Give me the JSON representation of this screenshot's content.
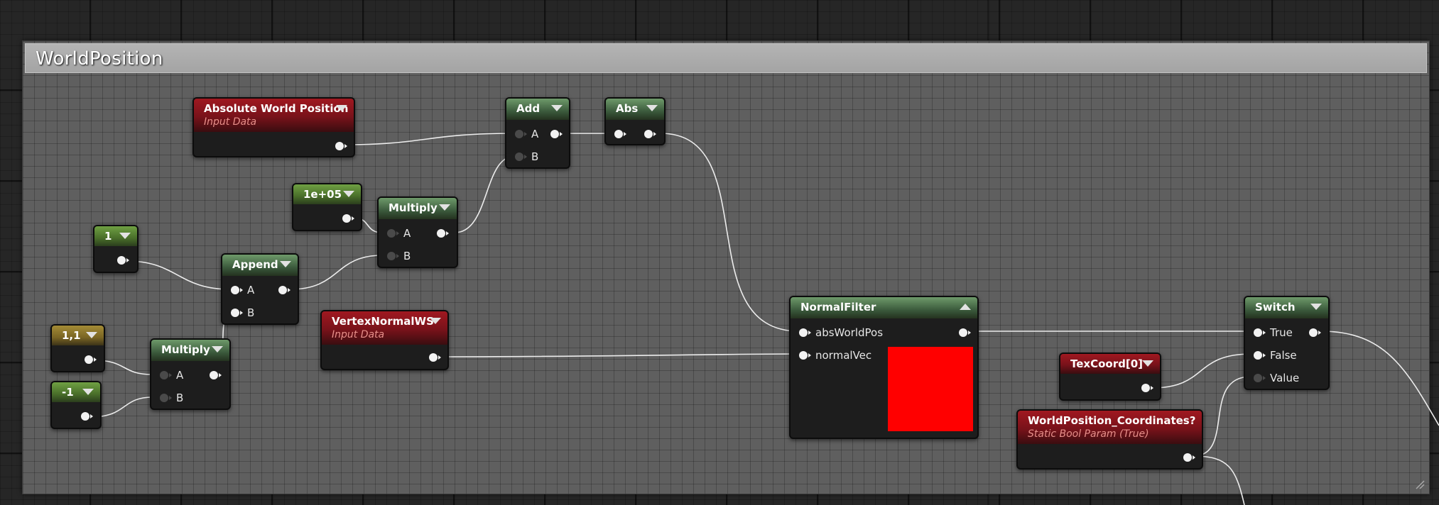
{
  "comment": {
    "title": "WorldPosition"
  },
  "nodes": {
    "abs_world_pos": {
      "title": "Absolute World Position",
      "subtitle": "Input Data"
    },
    "add": {
      "title": "Add",
      "pin_a": "A",
      "pin_b": "B"
    },
    "abs": {
      "title": "Abs"
    },
    "const_big": {
      "title": "1e+05"
    },
    "multiply_top": {
      "title": "Multiply",
      "pin_a": "A",
      "pin_b": "B"
    },
    "const_one": {
      "title": "1"
    },
    "append": {
      "title": "Append",
      "pin_a": "A",
      "pin_b": "B"
    },
    "vertex_normal": {
      "title": "VertexNormalWS",
      "subtitle": "Input Data"
    },
    "const_11": {
      "title": "1,1"
    },
    "const_neg1": {
      "title": "-1"
    },
    "multiply_bottom": {
      "title": "Multiply",
      "pin_a": "A",
      "pin_b": "B"
    },
    "normal_filter": {
      "title": "NormalFilter",
      "pin_abs": "absWorldPos",
      "pin_normal": "normalVec",
      "swatch_color": "#FF0000"
    },
    "tex_coord": {
      "title": "TexCoord[0]"
    },
    "static_bool": {
      "title": "WorldPosition_Coordinates?",
      "subtitle": "Static Bool Param (True)"
    },
    "switch": {
      "title": "Switch",
      "pin_true": "True",
      "pin_false": "False",
      "pin_value": "Value"
    }
  }
}
